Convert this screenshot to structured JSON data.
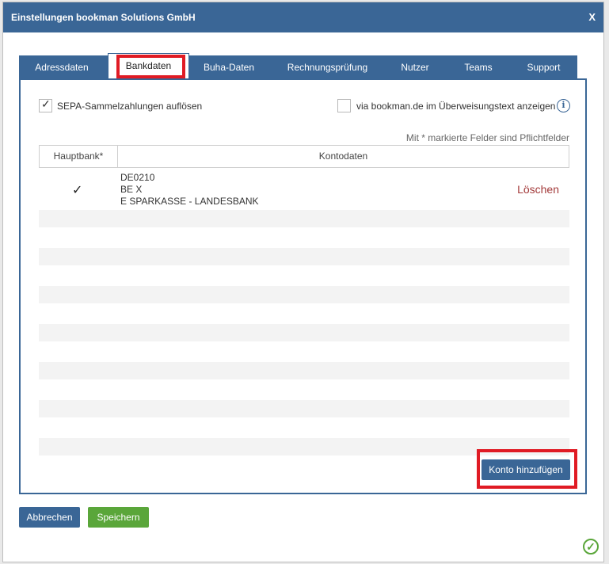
{
  "dialog": {
    "title": "Einstellungen bookman Solutions GmbH",
    "close_label": "X"
  },
  "tabs": [
    {
      "label": "Adressdaten",
      "active": false
    },
    {
      "label": "Bankdaten",
      "active": true
    },
    {
      "label": "Buha-Daten",
      "active": false
    },
    {
      "label": "Rechnungsprüfung",
      "active": false
    },
    {
      "label": "Nutzer",
      "active": false
    },
    {
      "label": "Teams",
      "active": false
    },
    {
      "label": "Support",
      "active": false
    }
  ],
  "options": {
    "sepa_label": "SEPA-Sammelzahlungen auflösen",
    "sepa_checked": true,
    "transfer_text_label": "via bookman.de im Überweisungstext anzeigen",
    "transfer_text_checked": false,
    "info_icon": "info-icon"
  },
  "required_note": "Mit * markierte Felder sind Pflichtfelder",
  "table": {
    "headers": [
      "Hauptbank*",
      "Kontodaten"
    ],
    "rows": [
      {
        "main_bank": true,
        "lines": [
          "DE0210",
          "BE        X",
          "E              SPARKASSE - LANDESBANK"
        ],
        "delete_label": "Löschen"
      }
    ]
  },
  "buttons": {
    "add_account": "Konto hinzufügen",
    "cancel": "Abbrechen",
    "save": "Speichern"
  },
  "colors": {
    "primary": "#3a6696",
    "save": "#5aa63a",
    "highlight": "#e01b24",
    "delete": "#a33a3a"
  }
}
